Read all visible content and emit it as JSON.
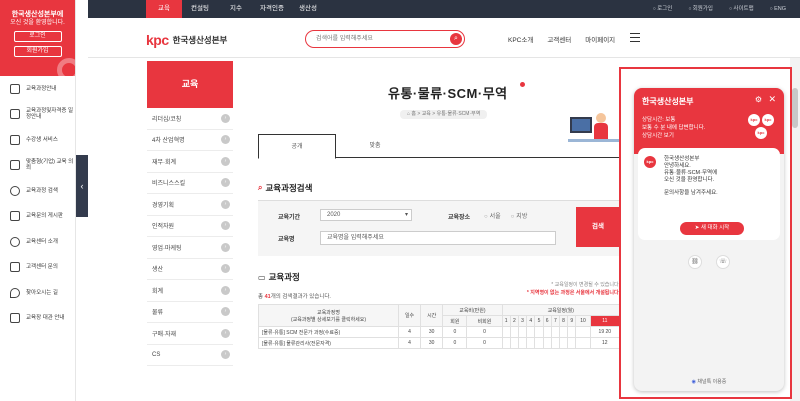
{
  "left_sidebar": {
    "promo_line1": "한국생산성본부에",
    "promo_line2": "오신 것을 환영합니다.",
    "login": "로그인",
    "join": "회원가입",
    "items": [
      {
        "icon": "book-icon",
        "label": "교육과정안내"
      },
      {
        "icon": "certificate-icon",
        "label": "교육과정및자격증 일정안내"
      },
      {
        "icon": "laptop-icon",
        "label": "수강생 서비스"
      },
      {
        "icon": "calendar-icon",
        "label": "맞춤형(기업) 교육 의뢰"
      },
      {
        "icon": "search-icon",
        "label": "교육과정 검색"
      },
      {
        "icon": "chat-icon",
        "label": "교육문의 게시판"
      },
      {
        "icon": "users-icon",
        "label": "교육센터 소개"
      },
      {
        "icon": "phone-icon",
        "label": "고객센터 문의"
      },
      {
        "icon": "map-pin-icon",
        "label": "찾아오시는 길"
      },
      {
        "icon": "shop-icon",
        "label": "교육장 대관 안내"
      }
    ]
  },
  "topnav": {
    "tabs": [
      "교육",
      "컨설팅",
      "지수",
      "자격인증",
      "생산성"
    ],
    "util": [
      "로그인",
      "회원가입",
      "사이트맵",
      "ENG"
    ]
  },
  "header": {
    "logo_mark": "kpc",
    "logo_name": "한국생산성본부",
    "search_placeholder": "검색어를 입력해주세요",
    "menu": [
      "KPC소개",
      "고객센터",
      "마이페이지"
    ]
  },
  "submenu": {
    "title": "교육",
    "items": [
      "리더십/코칭",
      "4차 산업혁명",
      "재무·회계",
      "비즈니스스킬",
      "경영기획",
      "인적자원",
      "영업·마케팅",
      "생산",
      "회계",
      "물류",
      "구매·자재",
      "CS"
    ]
  },
  "main": {
    "title": "유통·물류·SCM·무역",
    "breadcrumb": "⌂ 홈 > 교육 > 유통·물류·SCM·무역",
    "tabs": [
      "공개",
      "맞춤"
    ],
    "search_title": "교육과정검색",
    "form": {
      "year_label": "교육기간",
      "year_value": "2020",
      "place_label": "교육장소",
      "place_options": [
        "서울",
        "지방"
      ],
      "course_label": "교육명",
      "course_value": "교육명을 입력해주세요",
      "search_btn": "검색"
    },
    "list_title": "교육과정",
    "note1": "* 교육일정이 변경될 수 있습니다.",
    "note2": "* 지역명이 없는 과정은 서울에서 개설됩니다.",
    "count_prefix": "총 ",
    "count_value": "41",
    "count_suffix": "개의 검색결과가 있습니다.",
    "table": {
      "col_name": "교육과정명",
      "col_name_sub": "(교육과정별 상세보기를 클릭하세요)",
      "col_days": "일수",
      "col_hours": "시간",
      "col_fee": "교육비(만원)",
      "col_fee_member": "회원",
      "col_fee_nonmember": "비회원",
      "col_dates": "교육일정(월)",
      "months": [
        "1",
        "2",
        "3",
        "4",
        "5",
        "6",
        "7",
        "8",
        "9",
        "10",
        "11"
      ],
      "rows": [
        {
          "name": "[물류·유통] SCM 전문가 과정(수료증)",
          "days": "4",
          "hours": "30",
          "member": "0",
          "nonmember": "0",
          "m11": "19 20"
        },
        {
          "name": "[물류·유통] 물류관리사(전문자격)",
          "days": "4",
          "hours": "30",
          "member": "0",
          "nonmember": "0",
          "m11": "12"
        }
      ]
    }
  },
  "chat": {
    "title": "한국생산성본부",
    "status": "상담시간: 보통",
    "sub1": "보통 수 분 내에 답변합니다.",
    "sub2": "상담시간 보기",
    "sender": "한국생산성본부",
    "msg1": "안녕하세요.",
    "msg2": "유통·물류·SCM·무역에",
    "msg3": "오신 것을 환영합니다.",
    "msg4": "문의사항을 남겨주세요.",
    "start": "새 대화 시작",
    "powered": "채널톡 이용중"
  },
  "colors": {
    "brand": "#e8363f",
    "nav": "#2b3341"
  }
}
